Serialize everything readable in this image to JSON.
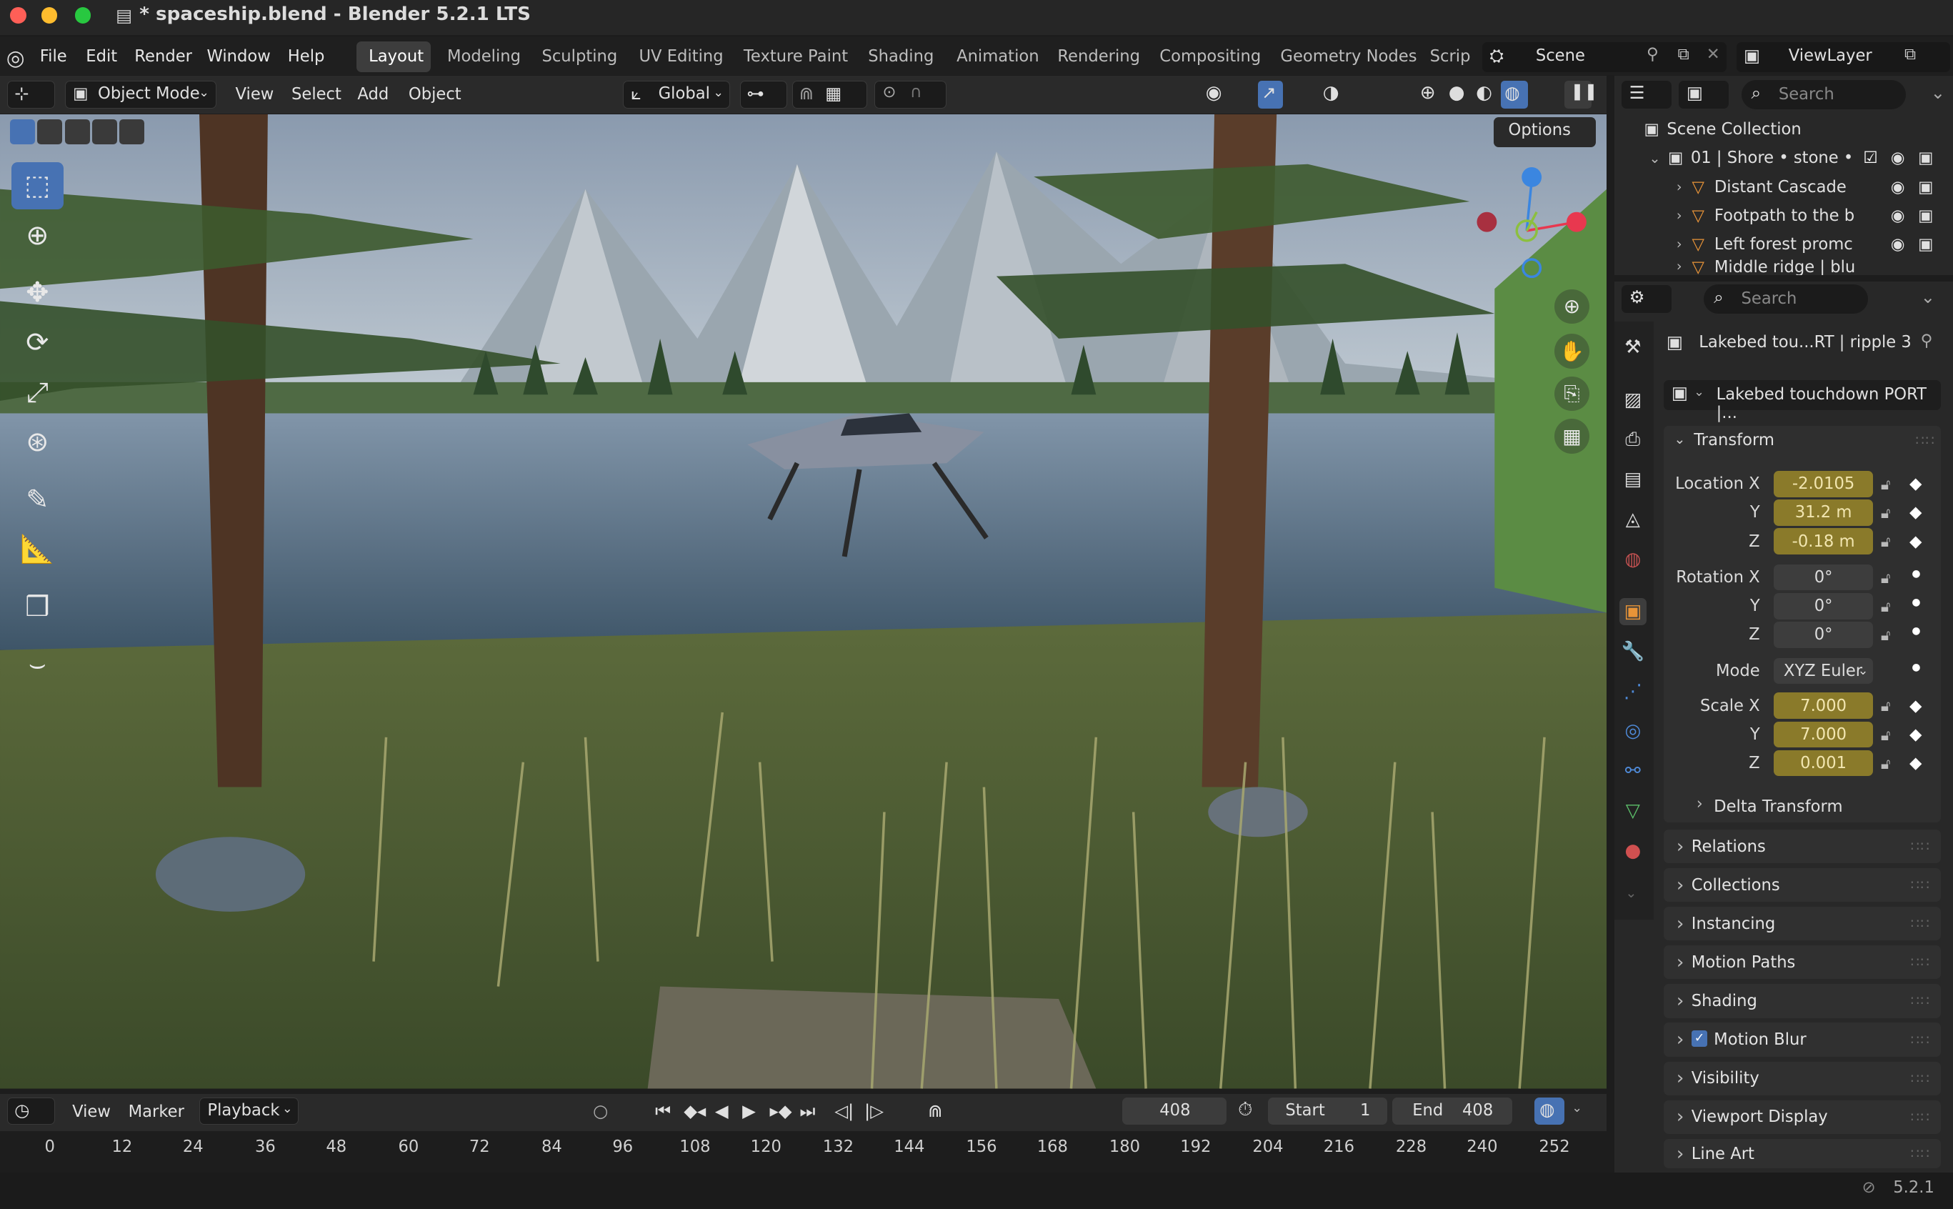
{
  "window": {
    "title": "* spaceship.blend - Blender 5.2.1 LTS"
  },
  "menubar": {
    "items": [
      "File",
      "Edit",
      "Render",
      "Window",
      "Help"
    ],
    "workspaces": [
      "Layout",
      "Modeling",
      "Sculpting",
      "UV Editing",
      "Texture Paint",
      "Shading",
      "Animation",
      "Rendering",
      "Compositing",
      "Geometry Nodes",
      "Scrip"
    ],
    "scene": "Scene",
    "view_layer": "ViewLayer"
  },
  "viewport_header": {
    "mode": "Object Mode",
    "menus": [
      "View",
      "Select",
      "Add",
      "Object"
    ],
    "orientation": "Global",
    "options": "Options"
  },
  "outliner": {
    "search_placeholder": "Search",
    "root": "Scene Collection",
    "collection": "01 | Shore • stone •",
    "items": [
      "Distant Cascade",
      "Footpath to the b",
      "Left forest promc",
      "Middle ridge | blu"
    ]
  },
  "properties": {
    "search_placeholder": "Search",
    "object_name": "Lakebed tou...RT | ripple 3",
    "data_name": "Lakebed touchdown PORT |...",
    "transform": {
      "title": "Transform",
      "location_label": "Location X",
      "loc_x": "-2.0105",
      "loc_y": "31.2 m",
      "loc_z": "-0.18 m",
      "rotation_label": "Rotation X",
      "rot_x": "0°",
      "rot_y": "0°",
      "rot_z": "0°",
      "mode_label": "Mode",
      "mode": "XYZ Euler",
      "scale_label": "Scale X",
      "scale_x": "7.000",
      "scale_y": "7.000",
      "scale_z": "0.001",
      "y": "Y",
      "z": "Z",
      "delta": "Delta Transform"
    },
    "sections": [
      "Relations",
      "Collections",
      "Instancing",
      "Motion Paths",
      "Shading",
      "Motion Blur",
      "Visibility",
      "Viewport Display",
      "Line Art"
    ]
  },
  "timeline": {
    "menus": [
      "View",
      "Marker",
      "Playback"
    ],
    "current_frame": "408",
    "start_label": "Start",
    "start": "1",
    "end_label": "End",
    "end": "408",
    "ticks": [
      "0",
      "12",
      "24",
      "36",
      "48",
      "60",
      "72",
      "84",
      "96",
      "108",
      "120",
      "132",
      "144",
      "156",
      "168",
      "180",
      "192",
      "204",
      "216",
      "228",
      "240",
      "252"
    ]
  },
  "status": {
    "version": "5.2.1"
  },
  "colors": {
    "accent": "#4772b3",
    "keyed_field": "#8a7a2a",
    "axis_x": "#e8384f",
    "axis_y": "#8cbf3f",
    "axis_z": "#3b86e0"
  }
}
